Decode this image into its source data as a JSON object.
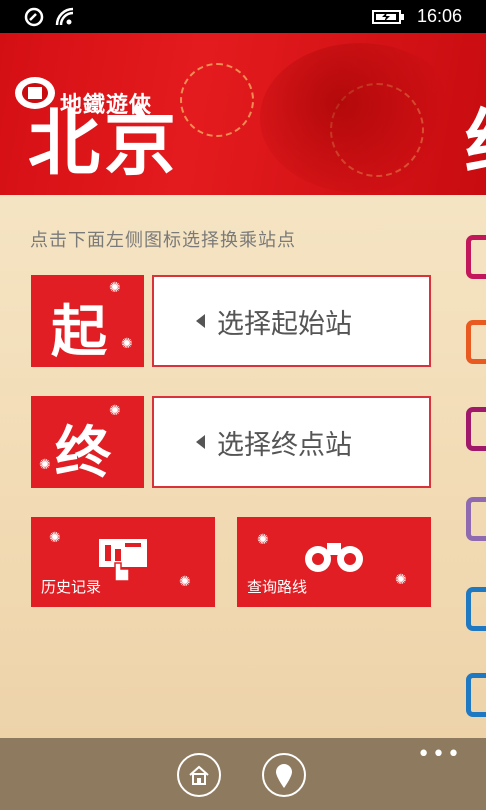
{
  "status_bar": {
    "time": "16:06"
  },
  "header": {
    "app_name": "地鐵遊俠",
    "city": "北京",
    "next_city_partial": "终"
  },
  "main": {
    "instruction": "点击下面左侧图标选择换乘站点",
    "start": {
      "icon_char": "起",
      "selector_label": "选择起始站"
    },
    "end": {
      "icon_char": "终",
      "selector_label": "选择终点站"
    },
    "history": {
      "label": "历史记录"
    },
    "search_route": {
      "label": "查询路线"
    }
  },
  "side_line_colors": [
    "#c2185b",
    "#e85a1f",
    "#a0186a",
    "#8f6ab0",
    "#1e78c2",
    "#1e78c2"
  ],
  "app_bar": {
    "more": "•••"
  },
  "colors": {
    "accent_red": "#e01e23",
    "app_bar": "#8e7a5e"
  }
}
